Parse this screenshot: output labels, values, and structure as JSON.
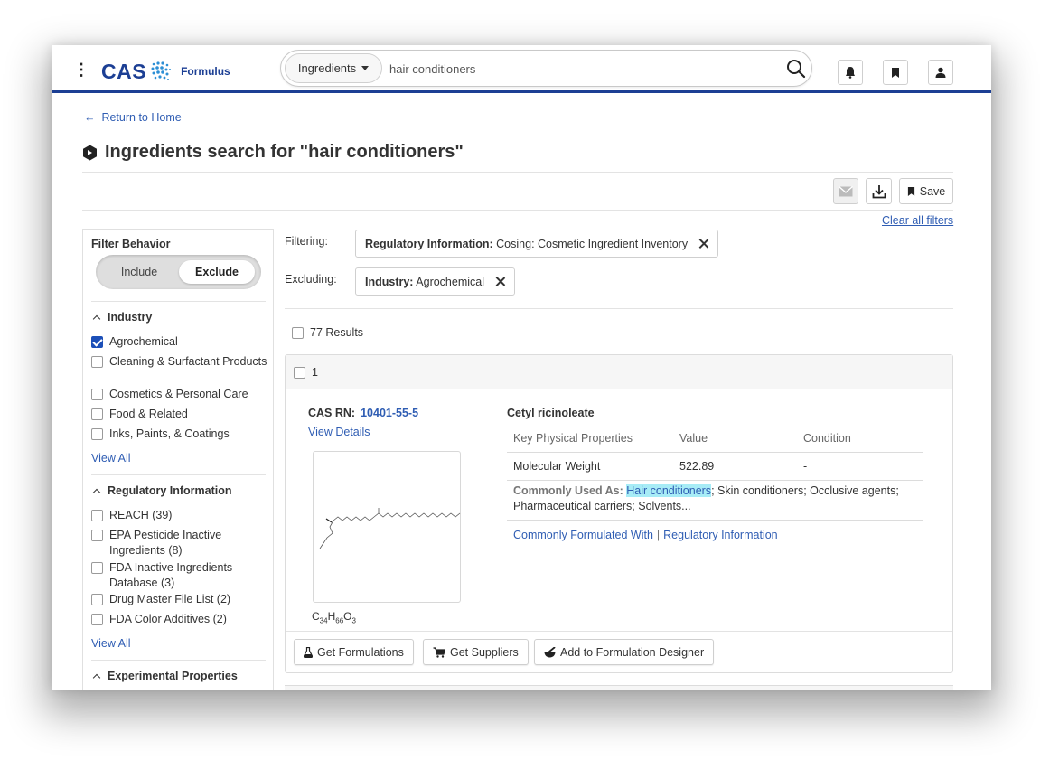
{
  "header": {
    "logo_text": "CAS",
    "product_name": "Formulus",
    "search_type": "Ingredients",
    "search_value": "hair conditioners",
    "icons": [
      "kebab-menu-icon",
      "search-icon",
      "bell-icon",
      "bookmark-icon",
      "user-icon"
    ]
  },
  "page": {
    "return_link": "Return to Home",
    "title": "Ingredients search for \"hair conditioners\"",
    "save_label": "Save",
    "clear_filters": "Clear all filters"
  },
  "sidebar": {
    "filter_behavior_title": "Filter Behavior",
    "toggle": {
      "include": "Include",
      "exclude": "Exclude",
      "active": "Exclude"
    },
    "industry": {
      "title": "Industry",
      "items": [
        {
          "label": "Agrochemical",
          "checked": true
        },
        {
          "label": "Cleaning & Surfactant Products",
          "checked": false
        },
        {
          "label": "Cosmetics & Personal Care",
          "checked": false
        },
        {
          "label": "Food & Related",
          "checked": false
        },
        {
          "label": "Inks, Paints, & Coatings",
          "checked": false
        }
      ],
      "view_all": "View All"
    },
    "regulatory": {
      "title": "Regulatory Information",
      "items": [
        {
          "label": "REACH (39)",
          "checked": false
        },
        {
          "label": "EPA Pesticide Inactive Ingredients (8)",
          "checked": false
        },
        {
          "label": "FDA Inactive Ingredients Database (3)",
          "checked": false
        },
        {
          "label": "Drug Master File List (2)",
          "checked": false
        },
        {
          "label": "FDA Color Additives (2)",
          "checked": false
        }
      ],
      "view_all": "View All"
    },
    "experimental_title": "Experimental Properties"
  },
  "filters": {
    "filtering_label": "Filtering:",
    "filtering_chip_key": "Regulatory Information:",
    "filtering_chip_value": "Cosing: Cosmetic Ingredient Inventory",
    "excluding_label": "Excluding:",
    "excluding_chip_key": "Industry:",
    "excluding_chip_value": "Agrochemical"
  },
  "results": {
    "count_label": "77 Results",
    "items": [
      {
        "index": "1",
        "cas_rn_label": "CAS RN:",
        "cas_rn": "10401-55-5",
        "view_details": "View Details",
        "formula": {
          "c": "34",
          "h": "66",
          "o": "3"
        },
        "name": "Cetyl ricinoleate",
        "table_headers": {
          "property": "Key Physical Properties",
          "value": "Value",
          "condition": "Condition"
        },
        "table_row": {
          "property": "Molecular Weight",
          "value": "522.89",
          "condition": "-"
        },
        "used_as_label": "Commonly Used As:",
        "used_as_highlight": "Hair conditioners",
        "used_as_rest": "; Skin conditioners; Occlusive agents; Pharmaceutical carriers; Solvents...",
        "link_formulated": "Commonly Formulated With",
        "link_separator": "|",
        "link_regulatory": "Regulatory Information",
        "actions": {
          "formulations": "Get Formulations",
          "suppliers": "Get Suppliers",
          "designer": "Add to Formulation Designer"
        }
      }
    ]
  }
}
